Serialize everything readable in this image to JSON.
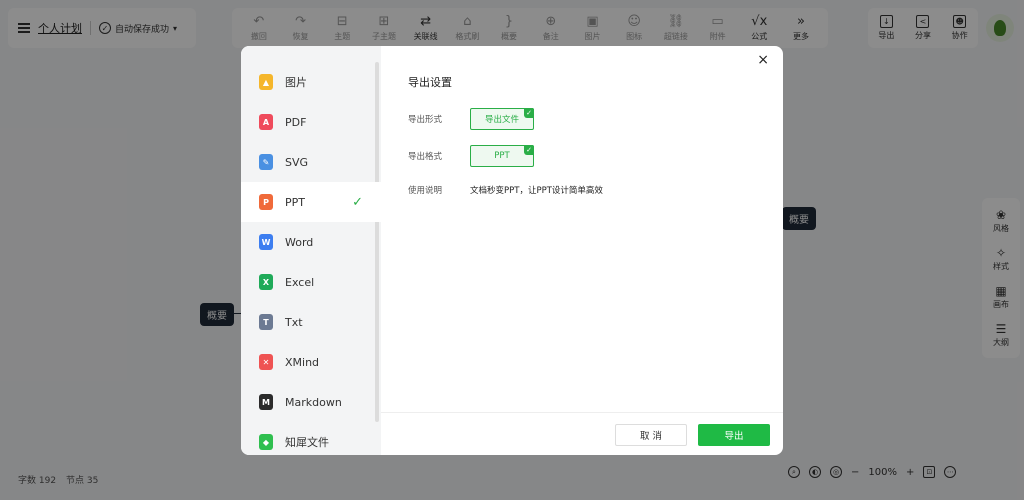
{
  "header": {
    "doc_title": "个人计划",
    "save_status": "自动保存成功"
  },
  "toolbar": [
    {
      "icon": "undo-icon",
      "glyph": "↶",
      "label": "撤回",
      "dim": true
    },
    {
      "icon": "redo-icon",
      "glyph": "↷",
      "label": "恢复",
      "dim": true
    },
    {
      "icon": "topic-icon",
      "glyph": "⊟",
      "label": "主题",
      "dim": true
    },
    {
      "icon": "subtopic-icon",
      "glyph": "⊞",
      "label": "子主题",
      "dim": true
    },
    {
      "icon": "relation-line-icon",
      "glyph": "⇄",
      "label": "关联线",
      "dim": false
    },
    {
      "icon": "format-brush-icon",
      "glyph": "⌂",
      "label": "格式刷",
      "dim": true
    },
    {
      "icon": "summary-icon",
      "glyph": "}",
      "label": "概要",
      "dim": true
    },
    {
      "icon": "note-icon",
      "glyph": "⊕",
      "label": "备注",
      "dim": true
    },
    {
      "icon": "image-icon",
      "glyph": "▣",
      "label": "图片",
      "dim": true
    },
    {
      "icon": "emoji-icon",
      "glyph": "☺",
      "label": "图标",
      "dim": true
    },
    {
      "icon": "link-icon",
      "glyph": "⛓",
      "label": "超链接",
      "dim": true
    },
    {
      "icon": "attachment-icon",
      "glyph": "▭",
      "label": "附件",
      "dim": true
    },
    {
      "icon": "formula-icon",
      "glyph": "√x",
      "label": "公式",
      "dim": false
    },
    {
      "icon": "more-icon",
      "glyph": "»",
      "label": "更多",
      "dim": false
    }
  ],
  "right_toolbar": [
    {
      "icon": "export-icon",
      "glyph": "↓",
      "label": "导出"
    },
    {
      "icon": "share-icon",
      "glyph": "<",
      "label": "分享"
    },
    {
      "icon": "collaborate-icon",
      "glyph": "☻",
      "label": "协作"
    }
  ],
  "side_panel": [
    {
      "icon": "palette-icon",
      "glyph": "❀",
      "label": "风格"
    },
    {
      "icon": "style-icon",
      "glyph": "✧",
      "label": "样式"
    },
    {
      "icon": "canvas-icon",
      "glyph": "▦",
      "label": "画布"
    },
    {
      "icon": "outline-icon",
      "glyph": "☰",
      "label": "大纲"
    }
  ],
  "canvas": {
    "node_left": "概要",
    "node_right": "概要"
  },
  "stats": {
    "word_count": "字数 192",
    "node_count": "节点 35"
  },
  "zoom": {
    "level": "100%",
    "minus": "−",
    "plus": "+"
  },
  "modal": {
    "title": "导出设置",
    "close": "×",
    "formats": [
      {
        "label": "图片",
        "icon": "image-file-icon",
        "glyph": "▲",
        "color": "#f5b62b",
        "active": false
      },
      {
        "label": "PDF",
        "icon": "pdf-file-icon",
        "glyph": "A",
        "color": "#ef4b5c",
        "active": false
      },
      {
        "label": "SVG",
        "icon": "svg-file-icon",
        "glyph": "✎",
        "color": "#4a90e2",
        "active": false
      },
      {
        "label": "PPT",
        "icon": "ppt-file-icon",
        "glyph": "P",
        "color": "#f06a3a",
        "active": true
      },
      {
        "label": "Word",
        "icon": "word-file-icon",
        "glyph": "W",
        "color": "#3d7ef0",
        "active": false
      },
      {
        "label": "Excel",
        "icon": "excel-file-icon",
        "glyph": "X",
        "color": "#1faa59",
        "active": false
      },
      {
        "label": "Txt",
        "icon": "txt-file-icon",
        "glyph": "T",
        "color": "#6c7a93",
        "active": false
      },
      {
        "label": "XMind",
        "icon": "xmind-file-icon",
        "glyph": "✕",
        "color": "#ef5353",
        "active": false
      },
      {
        "label": "Markdown",
        "icon": "markdown-file-icon",
        "glyph": "M",
        "color": "#2b2b2b",
        "active": false
      },
      {
        "label": "知犀文件",
        "icon": "zhixi-file-icon",
        "glyph": "◆",
        "color": "#2fbf4f",
        "active": false
      }
    ],
    "selected_check": "✓",
    "export_form_label": "导出形式",
    "export_form_value": "导出文件",
    "export_format_label": "导出格式",
    "export_format_value": "PPT",
    "usage_label": "使用说明",
    "usage_value": "文档秒变PPT，让PPT设计简单高效",
    "chip_tick": "✓",
    "cancel_label": "取 消",
    "export_label": "导出"
  }
}
